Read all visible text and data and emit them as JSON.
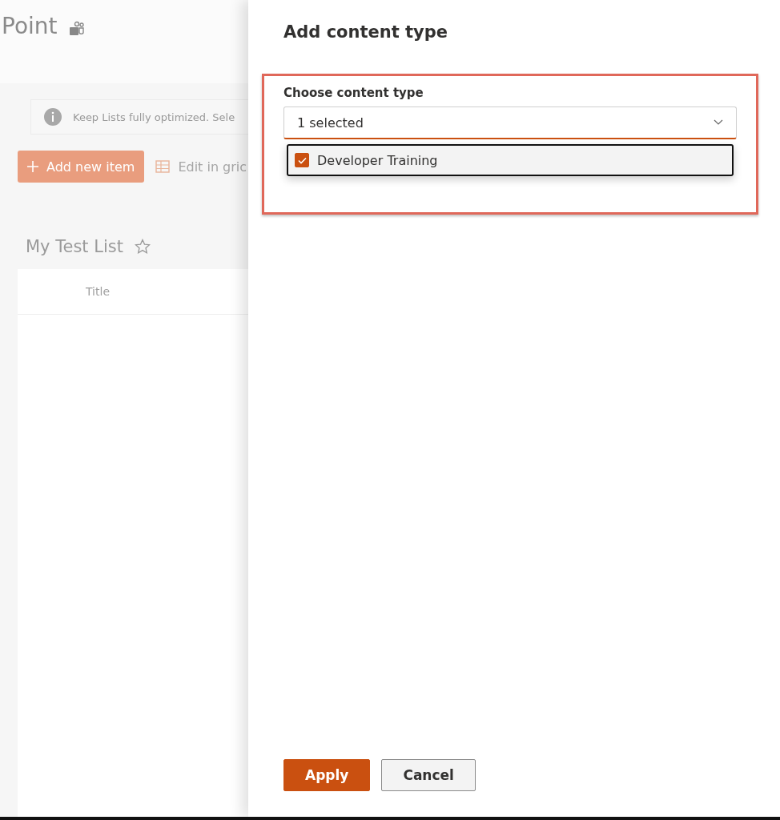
{
  "site": {
    "title": "Point"
  },
  "notice": {
    "text": "Keep Lists fully optimized.  Sele"
  },
  "toolbar": [
    {
      "kind": "primary",
      "label": "Add new item"
    },
    {
      "kind": "grid",
      "label": "Edit in gric"
    }
  ],
  "list": {
    "title": "My Test List",
    "favorite": false,
    "columns": [
      "Title"
    ]
  },
  "panel": {
    "title": "Add content type",
    "field": {
      "label": "Choose content type",
      "value": "1 selected",
      "expanded": true,
      "options": [
        {
          "label": "Developer Training",
          "checked": true
        }
      ]
    },
    "buttons": [
      {
        "kind": "primary",
        "label": "Apply"
      },
      {
        "kind": "default",
        "label": "Cancel"
      }
    ]
  }
}
